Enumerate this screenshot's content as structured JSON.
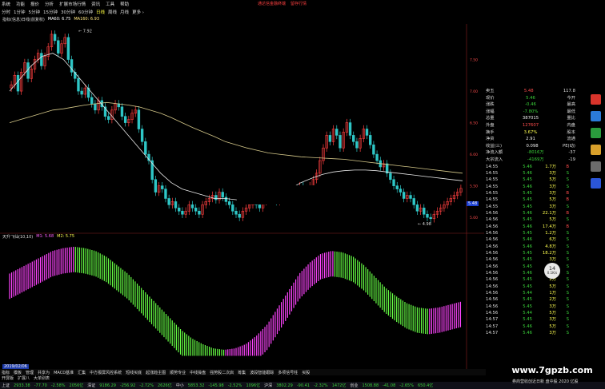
{
  "menubar": {
    "items": [
      "系统",
      "功能",
      "报价",
      "分析",
      "扩展市场行情",
      "资讯",
      "工具",
      "帮助"
    ]
  },
  "promo": {
    "left": "通达信金融终端",
    "right": "留存行情"
  },
  "periods": [
    "分时",
    "1分钟",
    "5分钟",
    "15分钟",
    "30分钟",
    "60分钟",
    "日线",
    "周线",
    "月线",
    "更多 ›"
  ],
  "active_period": "日线",
  "main_legend": {
    "title": "指标(信息)日线(前复权)",
    "ma60": "MA60: 6.75",
    "ma160": "MA160: 6.93"
  },
  "chart_labels": {
    "high": "7.92",
    "low": "4.98",
    "current": "5.48"
  },
  "osc_legend": {
    "title": "天升飞仙(10,10)",
    "m1": "M1: 5.68",
    "m2": "M2: 5.75"
  },
  "date_tag": "2019/02/06",
  "quote": {
    "rows": [
      {
        "label": "卖五",
        "value": "5.48",
        "extra": "117.8",
        "vc": "q-v"
      },
      {
        "label": "现价",
        "value": "5.46",
        "extra": "今开",
        "vc": "q-g"
      },
      {
        "label": "涨跌",
        "value": "-0.46",
        "extra": "最高",
        "vc": "q-g"
      },
      {
        "label": "涨幅",
        "value": "-7.80%",
        "extra": "最低",
        "vc": "q-g"
      },
      {
        "label": "总量",
        "value": "387015",
        "extra": "量比",
        "vc": "q-w"
      },
      {
        "label": "外盘",
        "value": "127607",
        "extra": "内盘",
        "vc": "q-v"
      },
      {
        "label": "换手",
        "value": "3.67%",
        "extra": "股本",
        "vc": "q-y"
      },
      {
        "label": "净资",
        "value": "2.91",
        "extra": "流通",
        "vc": "q-w"
      },
      {
        "label": "收益(三)",
        "value": "0.098",
        "extra": "PE(动)",
        "vc": "q-w"
      },
      {
        "label": "净流入额",
        "value": "-8016万",
        "extra": "-37",
        "vc": "q-g"
      },
      {
        "label": "大宗流入",
        "value": "-4169万",
        "extra": "-19",
        "vc": "q-g"
      }
    ],
    "ticks": [
      {
        "t": "14:55",
        "p": "5.46",
        "v": "1.7万",
        "s": "B"
      },
      {
        "t": "14:55",
        "p": "5.46",
        "v": "3万",
        "s": "S"
      },
      {
        "t": "14:55",
        "p": "5.45",
        "v": "5万",
        "s": "S"
      },
      {
        "t": "14:55",
        "p": "5.46",
        "v": "3万",
        "s": "S"
      },
      {
        "t": "14:55",
        "p": "5.45",
        "v": "3万",
        "s": "B"
      },
      {
        "t": "14:55",
        "p": "5.45",
        "v": "5万",
        "s": "B"
      },
      {
        "t": "14:55",
        "p": "5.45",
        "v": "3万",
        "s": "S"
      },
      {
        "t": "14:56",
        "p": "5.46",
        "v": "22.1万",
        "s": "B"
      },
      {
        "t": "14:56",
        "p": "5.45",
        "v": "5万",
        "s": "S"
      },
      {
        "t": "14:56",
        "p": "5.46",
        "v": "17.4万",
        "s": "B"
      },
      {
        "t": "14:56",
        "p": "5.45",
        "v": "1.2万",
        "s": "S"
      },
      {
        "t": "14:56",
        "p": "5.46",
        "v": "6万",
        "s": "S"
      },
      {
        "t": "14:56",
        "p": "5.46",
        "v": "4.8万",
        "s": "S"
      },
      {
        "t": "14:56",
        "p": "5.45",
        "v": "18.2万",
        "s": "S"
      },
      {
        "t": "14:56",
        "p": "5.45",
        "v": "3万",
        "s": "S"
      },
      {
        "t": "14:56",
        "p": "5.45",
        "v": "1万",
        "s": "S"
      },
      {
        "t": "14:56",
        "p": "5.46",
        "v": "3万",
        "s": "S"
      },
      {
        "t": "14:56",
        "p": "5.45",
        "v": "2万",
        "s": "S"
      },
      {
        "t": "14:56",
        "p": "5.45",
        "v": "5万",
        "s": "S"
      },
      {
        "t": "14:56",
        "p": "5.44",
        "v": "1万",
        "s": "S"
      },
      {
        "t": "14:56",
        "p": "5.45",
        "v": "2万",
        "s": "S"
      },
      {
        "t": "14:56",
        "p": "5.45",
        "v": "3万",
        "s": "S"
      },
      {
        "t": "14:56",
        "p": "5.44",
        "v": "5万",
        "s": "S"
      },
      {
        "t": "14:57",
        "p": "5.45",
        "v": "3万",
        "s": "S"
      },
      {
        "t": "14:57",
        "p": "5.46",
        "v": "5万",
        "s": "S"
      },
      {
        "t": "14:57",
        "p": "5.46",
        "v": "3万",
        "s": "S"
      }
    ]
  },
  "circle_badge": {
    "value": "14",
    "unit": "%",
    "sub": "0.1K/s"
  },
  "tabs": [
    "指标",
    "模板",
    "管理",
    "共享为",
    "MACD基准",
    "汇集",
    "中方报屏风控系统",
    "短线买底",
    "起涨趋主图",
    "顺势专业",
    "中线操盘",
    "强势股二次启",
    "筹集",
    "波段智能跟踪",
    "多项信号柱",
    "买股"
  ],
  "tabs2": [
    "开屏版",
    "扩展八",
    "大单别表"
  ],
  "status": [
    {
      "name": "上证",
      "value": "2933.38",
      "chg": "-77.70",
      "pct": "-2.58%",
      "amt": "2056亿",
      "cls": "down"
    },
    {
      "name": "深证",
      "value": "9186.29",
      "chg": "-256.92",
      "pct": "-2.72%",
      "amt": "2626亿",
      "cls": "down"
    },
    {
      "name": "中小",
      "value": "5853.32",
      "chg": "-145.98",
      "pct": "-2.52%",
      "amt": "1096亿",
      "cls": "down"
    },
    {
      "name": "沪深",
      "value": "3802.29",
      "chg": "-90.41",
      "pct": "-2.32%",
      "amt": "1472亿",
      "cls": "down"
    },
    {
      "name": "创业",
      "value": "1508.88",
      "chg": "-41.08",
      "pct": "-2.65%",
      "amt": "650.4亿",
      "cls": "down"
    }
  ],
  "watermark": "www.7gpzb.com",
  "news_toast": "券商营收创近日新 盘中股 2020 亿股",
  "colors": {
    "up": "#ff4040",
    "down": "#2ec6c6",
    "ma_long": "#d6c98a",
    "ma_mid": "#e8e8e8",
    "osc_pink": "#ff44ff",
    "osc_green": "#66ff44"
  },
  "chart_data": {
    "type": "candlestick",
    "note": "daily candles approximating shown price path",
    "close": [
      7.1,
      7.25,
      7.0,
      7.3,
      7.45,
      7.2,
      7.35,
      7.5,
      7.6,
      7.4,
      7.55,
      7.7,
      7.9,
      7.8,
      7.6,
      7.75,
      7.85,
      7.5,
      7.3,
      7.2,
      7.0,
      6.95,
      7.05,
      6.9,
      6.8,
      6.7,
      6.85,
      6.75,
      6.6,
      6.55,
      6.7,
      6.8,
      6.75,
      6.6,
      6.5,
      6.55,
      6.65,
      6.7,
      6.4,
      6.2,
      6.0,
      5.9,
      5.6,
      5.4,
      5.5,
      5.45,
      5.3,
      5.2,
      5.25,
      5.15,
      5.1,
      5.05,
      5.1,
      5.2,
      5.15,
      5.1,
      5.05,
      5.2,
      5.25,
      5.3,
      5.35,
      5.28,
      5.4,
      5.32,
      5.25,
      5.2,
      5.1,
      5.05,
      5.0,
      5.1,
      5.15,
      5.2,
      5.25,
      5.2,
      5.15,
      5.25,
      5.3,
      5.35,
      5.3,
      5.25,
      5.3,
      5.35,
      5.4,
      5.3,
      5.35,
      5.45,
      5.5,
      5.45,
      5.4,
      5.5,
      5.6,
      5.7,
      5.9,
      6.1,
      6.3,
      6.2,
      6.4,
      6.3,
      6.1,
      6.35,
      6.5,
      6.3,
      6.2,
      6.1,
      6.25,
      6.4,
      6.3,
      6.15,
      6.0,
      5.9,
      5.8,
      5.85,
      5.7,
      5.6,
      5.5,
      5.45,
      5.4,
      5.3,
      5.35,
      5.3,
      5.2,
      5.1,
      5.15,
      5.05,
      5.0,
      4.98,
      5.05,
      5.1,
      5.15,
      5.2,
      5.25,
      5.3,
      5.35,
      5.4,
      5.46
    ],
    "ma_long": [
      6.5,
      6.55,
      6.6,
      6.65,
      6.7,
      6.72,
      6.75,
      6.78,
      6.8,
      6.82,
      6.8,
      6.78,
      6.75,
      6.7,
      6.65,
      6.58,
      6.5,
      6.42,
      6.35,
      6.28,
      6.2,
      6.15,
      6.1,
      6.06,
      6.02,
      6.0,
      5.98,
      5.96,
      5.95,
      5.94,
      5.93,
      5.92,
      5.9,
      5.88,
      5.86,
      5.84,
      5.82,
      5.8,
      5.78,
      5.76,
      5.74,
      5.72,
      5.7
    ],
    "ma_mid": [
      7.0,
      7.2,
      7.4,
      7.55,
      7.6,
      7.5,
      7.3,
      7.1,
      6.9,
      6.7,
      6.5,
      6.3,
      6.1,
      5.9,
      5.7,
      5.55,
      5.45,
      5.4,
      5.35,
      5.3,
      5.3,
      5.28,
      5.27,
      5.26,
      5.3,
      5.38,
      5.45,
      5.55,
      5.62,
      5.68,
      5.72,
      5.74,
      5.75,
      5.75,
      5.74,
      5.72,
      5.7,
      5.68,
      5.66,
      5.64,
      5.62,
      5.6,
      5.58
    ],
    "osc": [
      0.2,
      0.4,
      0.6,
      0.8,
      1.0,
      1.1,
      1.15,
      1.1,
      1.0,
      0.8,
      0.5,
      0.2,
      -0.2,
      -0.6,
      -1.0,
      -1.4,
      -1.8,
      -2.1,
      -2.3,
      -2.45,
      -2.5,
      -2.45,
      -2.3,
      -2.0,
      -1.6,
      -1.0,
      -0.4,
      0.2,
      0.6,
      0.9,
      1.0,
      0.95,
      0.8,
      0.5,
      0.1,
      -0.3,
      -0.6,
      -0.85,
      -1.0,
      -1.05,
      -1.0,
      -0.9,
      -0.8
    ]
  }
}
